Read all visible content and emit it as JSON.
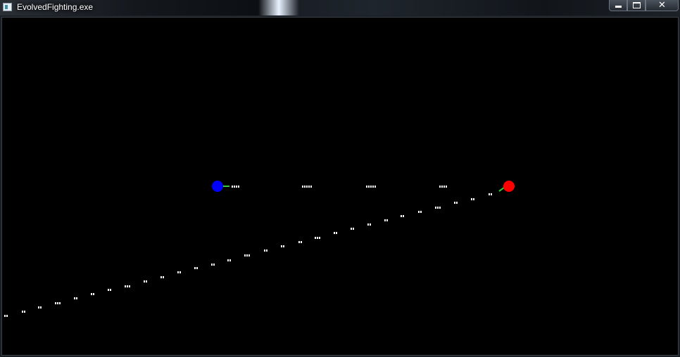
{
  "window": {
    "title": "EvolvedFighting.exe",
    "title_icon": "app-window-icon",
    "buttons": {
      "minimize": "minimize-icon",
      "maximize": "maximize-icon",
      "close_label": "✕"
    }
  },
  "game": {
    "background_color": "#000000",
    "blue_fighter": {
      "color": "#0000ff",
      "aim_color": "#33cc33"
    },
    "red_fighter": {
      "color": "#ff0000",
      "aim_color": "#33cc33"
    },
    "projectile_color": "#ffffff"
  }
}
